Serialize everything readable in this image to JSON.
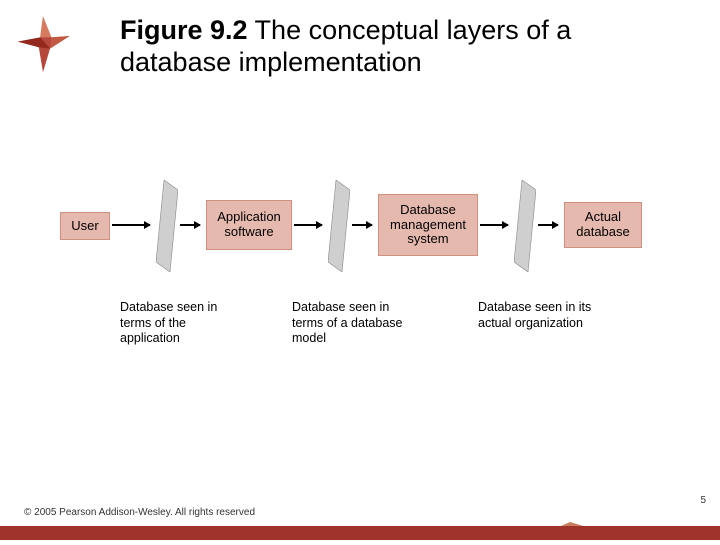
{
  "title": {
    "prefix": "Figure 9.2",
    "rest": "  The conceptual layers of a database implementation"
  },
  "layers": [
    {
      "label": "User"
    },
    {
      "label": "Application software"
    },
    {
      "label": "Database management system"
    },
    {
      "label": "Actual database"
    }
  ],
  "captions": [
    "Database seen in terms of the application",
    "Database seen in terms of a database model",
    "Database seen in its actual organization"
  ],
  "copyright": "© 2005 Pearson Addison-Wesley. All rights reserved",
  "page_number": "5",
  "colors": {
    "box_fill": "#e6b9ae",
    "box_border": "#d09080",
    "accent": "#a0342a",
    "accent_light": "#c97e60"
  }
}
